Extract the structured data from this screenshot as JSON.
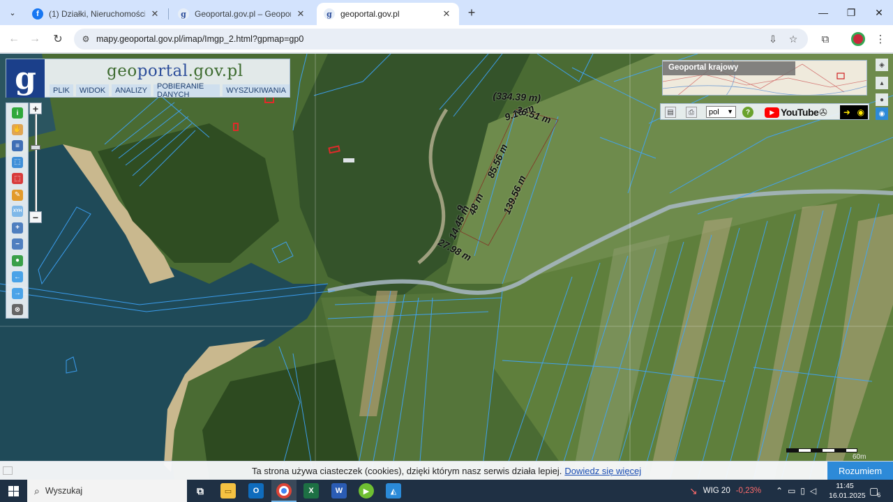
{
  "browser": {
    "tabs": [
      {
        "label": "(1) Działki, Nieruchomości Mało",
        "icon": "facebook-icon",
        "active": false
      },
      {
        "label": "Geoportal.gov.pl – Geoportal In",
        "icon": "geoportal-icon",
        "active": false
      },
      {
        "label": "geoportal.gov.pl",
        "icon": "geoportal-icon",
        "active": true
      }
    ],
    "new_tab": "+",
    "url": "mapy.geoportal.gov.pl/imap/Imgp_2.html?gpmap=gp0",
    "window_controls": [
      "minimize-icon",
      "restore-icon",
      "close-icon"
    ]
  },
  "geoportal": {
    "logo_text_1": "geo",
    "logo_text_2": "portal",
    "logo_text_3": ".gov.pl",
    "menu": [
      "PLIK",
      "WIDOK",
      "ANALIZY",
      "POBIERANIE DANYCH",
      "WYSZUKIWANIA"
    ],
    "tools": [
      {
        "icon": "info-icon",
        "color": "#2fa83b",
        "glyph": "i"
      },
      {
        "icon": "pan-hand-icon",
        "color": "#e0a553",
        "glyph": "✋"
      },
      {
        "icon": "layers-list-icon",
        "color": "#3f6fb5",
        "glyph": "≡"
      },
      {
        "icon": "select-rect-icon",
        "color": "#3f8fd8",
        "glyph": "⬚"
      },
      {
        "icon": "select-red-icon",
        "color": "#d83b3b",
        "glyph": "⬚"
      },
      {
        "icon": "pencil-icon",
        "color": "#e29a2b",
        "glyph": "✎"
      },
      {
        "icon": "xyh-coordinates-icon",
        "color": "#7fb8e8",
        "glyph": "XYH"
      },
      {
        "icon": "zoom-in-icon",
        "color": "#4f7fbf",
        "glyph": "+"
      },
      {
        "icon": "zoom-out-icon",
        "color": "#4f7fbf",
        "glyph": "−"
      },
      {
        "icon": "globe-icon",
        "color": "#3aa048",
        "glyph": "●"
      },
      {
        "icon": "back-arrow-icon",
        "color": "#4aa3e8",
        "glyph": "←"
      },
      {
        "icon": "forward-arrow-icon",
        "color": "#4aa3e8",
        "glyph": "→"
      },
      {
        "icon": "full-extent-icon",
        "color": "#666666",
        "glyph": "⊗"
      }
    ],
    "zoom_in": "+",
    "zoom_out": "−",
    "zoom_level_fraction": 0.33,
    "overview_title": "Geoportal krajowy",
    "language": "pol",
    "youtube_label": "YouTube",
    "measurements": [
      "(334.39 m)",
      "9.16 m",
      "36.51 m",
      "85.56 m",
      "139.56 m",
      "9",
      "14.45 m",
      "48 m",
      "27.98 m"
    ],
    "scale_label": "60m",
    "cookie_text": "Ta strona używa ciasteczek (cookies), dzięki którym nasz serwis działa lepiej.",
    "cookie_link": "Dowiedz się więcej",
    "cookie_button": "Rozumiem"
  },
  "taskbar": {
    "search_placeholder": "Wyszukaj",
    "apps": [
      "task-view-icon",
      "file-explorer-icon",
      "outlook-icon",
      "chrome-icon",
      "excel-icon",
      "word-icon",
      "media-player-icon",
      "photos-icon"
    ],
    "market_name": "WIG 20",
    "market_change": "-0,23%",
    "market_change_color": "#ff6b6b",
    "time": "11:45",
    "date": "16.01.2025",
    "notification_count": "6"
  }
}
